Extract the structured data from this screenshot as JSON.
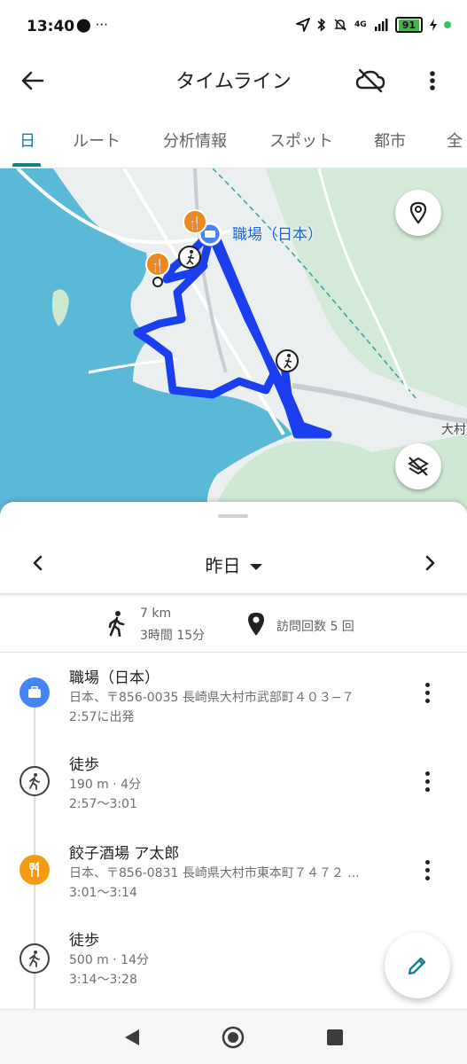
{
  "status_bar": {
    "time": "13:40",
    "left_icons": "⬤ ···",
    "network": "4G",
    "battery": "91"
  },
  "app_bar": {
    "title": "タイムライン"
  },
  "tabs": [
    {
      "label": "日",
      "active": true
    },
    {
      "label": "ルート",
      "active": false
    },
    {
      "label": "分析情報",
      "active": false
    },
    {
      "label": "スポット",
      "active": false
    },
    {
      "label": "都市",
      "active": false
    },
    {
      "label": "全",
      "active": false
    }
  ],
  "map": {
    "place_label": "職場（日本）",
    "town_label": "大村",
    "colors": {
      "water": "#56b8d9",
      "route": "#1a3ff0",
      "land": "#eef0f0",
      "green": "#cfe8d4"
    }
  },
  "date_nav": {
    "label": "昨日"
  },
  "summary": {
    "distance": "7 km",
    "duration": "3時間 15分",
    "visits": "訪問回数 5 回"
  },
  "timeline": [
    {
      "type": "place",
      "icon": "briefcase-icon",
      "title": "職場（日本）",
      "line1": "日本、〒856-0035 長崎県大村市武部町４０３−７",
      "line2": "2:57に出発"
    },
    {
      "type": "walk",
      "icon": "walking-icon",
      "title": "徒歩",
      "line1": "190 m · 4分",
      "line2": "2:57〜3:01"
    },
    {
      "type": "place",
      "icon": "restaurant-icon",
      "title": "餃子酒場 ア太郎",
      "line1": "日本、〒856-0831 長崎県大村市東本町７４７２ ...",
      "line2": "3:01〜3:14"
    },
    {
      "type": "walk",
      "icon": "walking-icon",
      "title": "徒歩",
      "line1": "500 m · 14分",
      "line2": "3:14〜3:28"
    }
  ]
}
